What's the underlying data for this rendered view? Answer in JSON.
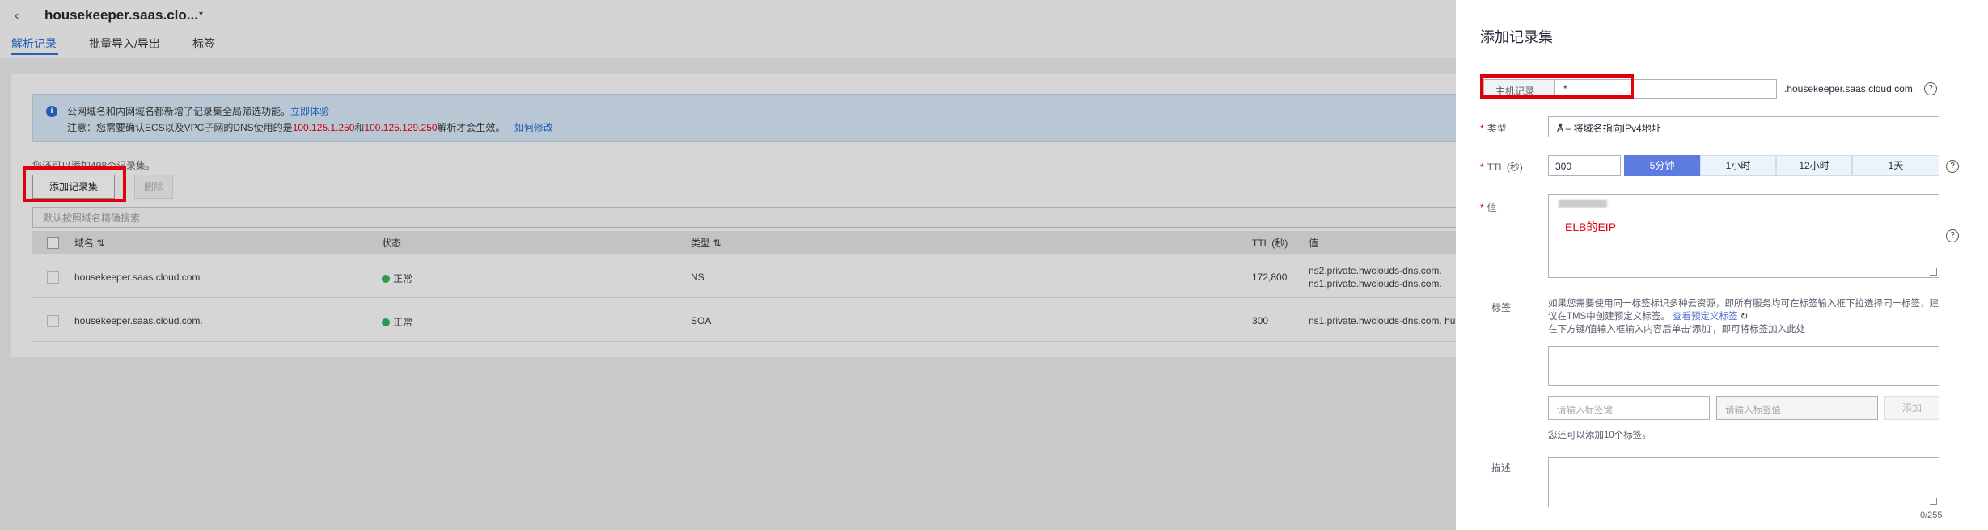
{
  "header": {
    "back_icon": "chevron-left-icon",
    "zone_name": "housekeeper.saas.clo...",
    "zone_caret": "▾",
    "tabs": [
      {
        "label": "解析记录",
        "active": true
      },
      {
        "label": "批量导入/导出",
        "active": false
      },
      {
        "label": "标签",
        "active": false
      }
    ]
  },
  "notice": {
    "icon": "info-icon",
    "line1_text": "公网域名和内网域名都新增了记录集全局筛选功能。",
    "line1_link": "立即体验",
    "line2_prefix": "注意：您需要确认ECS以及VPC子网的DNS使用的是",
    "line2_ip1": "100.125.1.250",
    "line2_and": "和",
    "line2_ip2": "100.125.129.250",
    "line2_suffix": "解析才会生效。",
    "line2_link": "如何修改"
  },
  "toolbar": {
    "quota_text": "您还可以添加498个记录集。",
    "add_label": "添加记录集",
    "delete_label": "删除",
    "search_placeholder": "默认按照域名精确搜索"
  },
  "table": {
    "columns": [
      "域名",
      "状态",
      "类型",
      "TTL (秒)",
      "值"
    ],
    "sort_icon": "⇅",
    "rows": [
      {
        "domain": "housekeeper.saas.cloud.com.",
        "status": "正常",
        "type": "NS",
        "ttl": "172,800",
        "value1": "ns2.private.hwclouds-dns.com.",
        "value2": "ns1.private.hwclouds-dns.com."
      },
      {
        "domain": "housekeeper.saas.cloud.com.",
        "status": "正常",
        "type": "SOA",
        "ttl": "300",
        "value1": "ns1.private.hwclouds-dns.com. hu",
        "value2": ""
      }
    ]
  },
  "drawer": {
    "title": "添加记录集",
    "host_label": "主机记录",
    "host_value": "*",
    "host_suffix": ".housekeeper.saas.cloud.com.",
    "type_label": "类型",
    "type_value": "A – 将域名指向IPv4地址",
    "ttl_label": "TTL (秒)",
    "ttl_value": "300",
    "ttl_options": [
      "5分钟",
      "1小时",
      "12小时",
      "1天"
    ],
    "value_label": "值",
    "value_annotation": "ELB的EIP",
    "tag_label": "标签",
    "tag_desc_1": "如果您需要使用同一标签标识多种云资源，即所有服务均可在标签输入框下拉选择同一标签，建议在TMS中创建预定义标签。",
    "tag_desc_link": "查看预定义标签",
    "tag_desc_2": "在下方键/值输入框输入内容后单击'添加'，即可将标签加入此处",
    "tag_key_placeholder": "请输入标签键",
    "tag_value_placeholder": "请输入标签值",
    "tag_add_label": "添加",
    "tag_remaining": "您还可以添加10个标签。",
    "desc_label": "描述",
    "desc_counter": "0/255",
    "help_icon": "?"
  }
}
